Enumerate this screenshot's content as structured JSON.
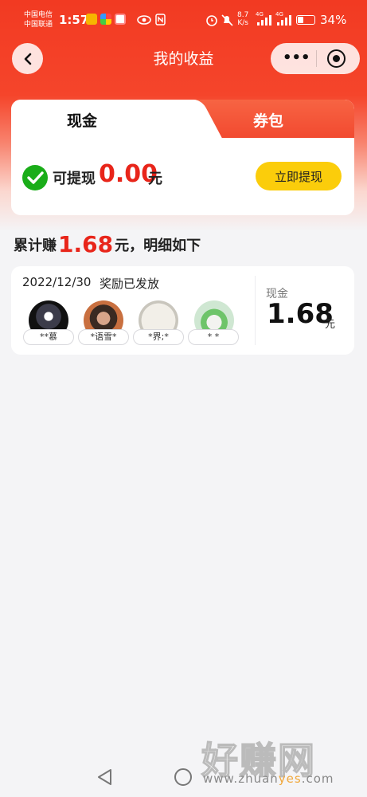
{
  "status_bar": {
    "carrier1": "中国电信",
    "carrier2": "中国联通",
    "time": "1:57",
    "net_speed": "8.7",
    "net_unit": "K/s",
    "signal1_label": "4G",
    "signal2_label": "4G",
    "battery_pct": "34%",
    "battery_level": 0.34
  },
  "nav": {
    "title": "我的收益",
    "more_glyph": "•••"
  },
  "tabs": [
    {
      "label": "现金",
      "active": true
    },
    {
      "label": "券包",
      "active": false
    }
  ],
  "withdraw": {
    "label": "可提现",
    "amount": "0.00",
    "unit": "元",
    "button": "立即提现"
  },
  "summary": {
    "prefix": "累计赚",
    "amount": "1.68",
    "suffix": "元，明细如下"
  },
  "record": {
    "date": "2022/12/30",
    "status": "奖励已发放",
    "users": [
      {
        "name": "**慕",
        "avatar": "anime-dark"
      },
      {
        "name": "*语雪*",
        "avatar": "portrait"
      },
      {
        "name": "*界;*",
        "avatar": "calligraphy"
      },
      {
        "name": "*      *",
        "avatar": "anime-green"
      }
    ],
    "currency_label": "现金",
    "amount": "1.68",
    "unit": "元"
  },
  "watermark": {
    "big": "好赚网",
    "url_pre": "www.zhuan",
    "url_mid": "yes",
    "url_post": ".com"
  },
  "colors": {
    "header_red": "#f23a22",
    "amount_red": "#e8251a",
    "button_yellow": "#fbcd0b",
    "wechat_green": "#1aad19"
  }
}
